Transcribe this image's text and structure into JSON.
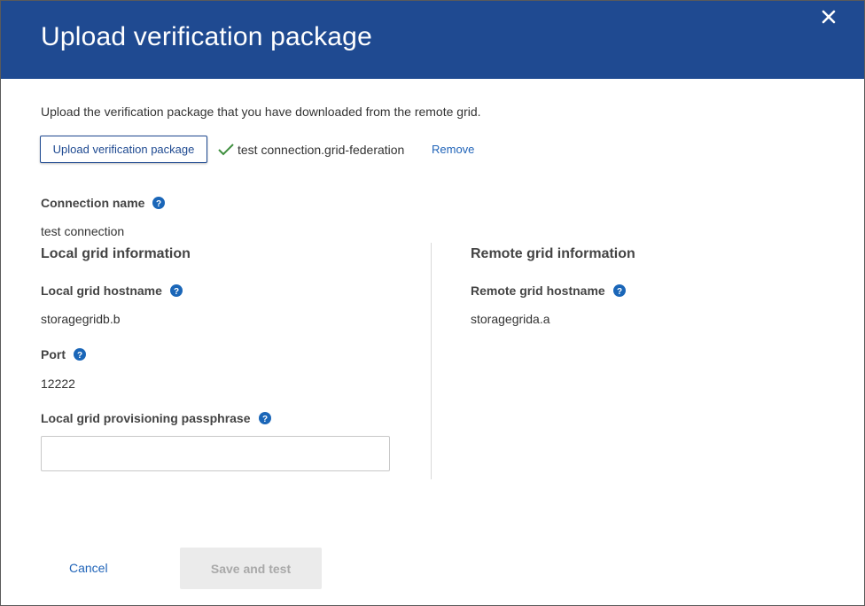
{
  "dialog": {
    "title": "Upload verification package",
    "close_icon": "close-icon"
  },
  "upload": {
    "intro": "Upload the verification package that you have downloaded from the remote grid.",
    "button_label": "Upload verification package",
    "file_name": "test connection.grid-federation",
    "file_status_icon": "checkmark-icon",
    "remove_label": "Remove"
  },
  "connection": {
    "name_label": "Connection name",
    "name_value": "test connection"
  },
  "local": {
    "section_title": "Local grid information",
    "hostname_label": "Local grid hostname",
    "hostname_value": "storagegridb.b",
    "port_label": "Port",
    "port_value": "12222",
    "passphrase_label": "Local grid provisioning passphrase",
    "passphrase_value": ""
  },
  "remote": {
    "section_title": "Remote grid information",
    "hostname_label": "Remote grid hostname",
    "hostname_value": "storagegrida.a"
  },
  "footer": {
    "cancel_label": "Cancel",
    "save_label": "Save and test"
  },
  "colors": {
    "header_bg": "#1f4a91",
    "link": "#1f63b8",
    "help_icon": "#1a66b8",
    "check": "#3f8f3f",
    "disabled_bg": "#ebebeb",
    "disabled_text": "#a9a9a9"
  }
}
